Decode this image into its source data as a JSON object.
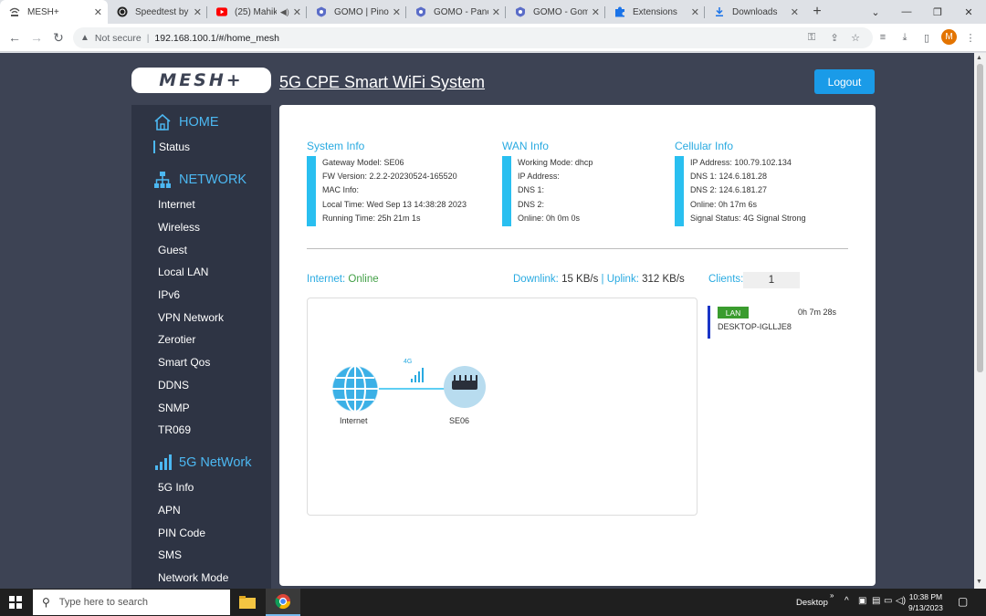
{
  "browser": {
    "tabs": [
      {
        "label": "MESH+",
        "icon": "wifi-icon",
        "active": true
      },
      {
        "label": "Speedtest by O",
        "icon": "speedtest-icon",
        "active": false
      },
      {
        "label": "(25) Mahik",
        "icon": "youtube-icon",
        "active": false
      },
      {
        "label": "GOMO | Pinoy",
        "icon": "gomo-icon",
        "active": false
      },
      {
        "label": "GOMO - Pano",
        "icon": "gomo-icon",
        "active": false
      },
      {
        "label": "GOMO - Gomo",
        "icon": "gomo-icon",
        "active": false
      },
      {
        "label": "Extensions",
        "icon": "puzzle-icon",
        "active": false
      },
      {
        "label": "Downloads",
        "icon": "download-icon",
        "active": false
      }
    ],
    "new_tab": "+",
    "address": {
      "security_label": "Not secure",
      "url": "192.168.100.1/#/home_mesh"
    },
    "profile_initial": "M"
  },
  "header": {
    "logo_text": "MESH+",
    "title": "5G CPE Smart WiFi System",
    "logout_label": "Logout"
  },
  "sidebar": {
    "sections": [
      {
        "title": "HOME",
        "icon": "home-icon",
        "items": [
          "Status"
        ]
      },
      {
        "title": "NETWORK",
        "icon": "network-icon",
        "items": [
          "Internet",
          "Wireless",
          "Guest",
          "Local LAN",
          "IPv6",
          "VPN Network",
          "Zerotier",
          "Smart Qos",
          "DDNS",
          "SNMP",
          "TR069"
        ]
      },
      {
        "title": "5G NetWork",
        "icon": "signal-bars-icon",
        "items": [
          "5G Info",
          "APN",
          "PIN Code",
          "SMS",
          "Network Mode"
        ]
      }
    ],
    "active_item": "Status"
  },
  "system_info": {
    "title": "System Info",
    "lines": [
      "Gateway Model:  SE06",
      "FW Version:  2.2.2-20230524-165520",
      "MAC Info:",
      "Local Time:  Wed Sep 13 14:38:28 2023",
      "Running Time:  25h 21m 1s"
    ]
  },
  "wan_info": {
    "title": "WAN Info",
    "lines": [
      "Working Mode:  dhcp",
      "IP Address:",
      "DNS 1:",
      "DNS 2:",
      "Online:  0h 0m 0s"
    ]
  },
  "cellular_info": {
    "title": "Cellular Info",
    "lines": [
      "IP Address:  100.79.102.134",
      "DNS 1:  124.6.181.28",
      "DNS 2:  124.6.181.27",
      "Online:  0h 17m 6s",
      "Signal Status:  4G Signal Strong"
    ]
  },
  "status_bar": {
    "internet_label": "Internet:",
    "internet_value": "Online",
    "downlink_label": "Downlink:",
    "downlink_value": "15 KB/s",
    "divider": "|",
    "uplink_label": "Uplink:",
    "uplink_value": "312 KB/s",
    "clients_label": "Clients:",
    "clients_value": "1"
  },
  "topology": {
    "internet_label": "Internet",
    "link_label": "4G",
    "device_label": "SE06"
  },
  "clients": [
    {
      "type": "LAN",
      "time": "0h 7m 28s",
      "name": "DESKTOP-IGLLJE8"
    }
  ],
  "taskbar": {
    "search_placeholder": "Type here to search",
    "desktop_label": "Desktop",
    "time": "10:38 PM",
    "date": "9/13/2023"
  },
  "colors": {
    "page_bg": "#3d4354",
    "sidebar_bg": "#2e3444",
    "accent": "#29aae1",
    "online": "#43a047",
    "logout": "#1a9be8",
    "lan_badge": "#3a9c2e"
  }
}
